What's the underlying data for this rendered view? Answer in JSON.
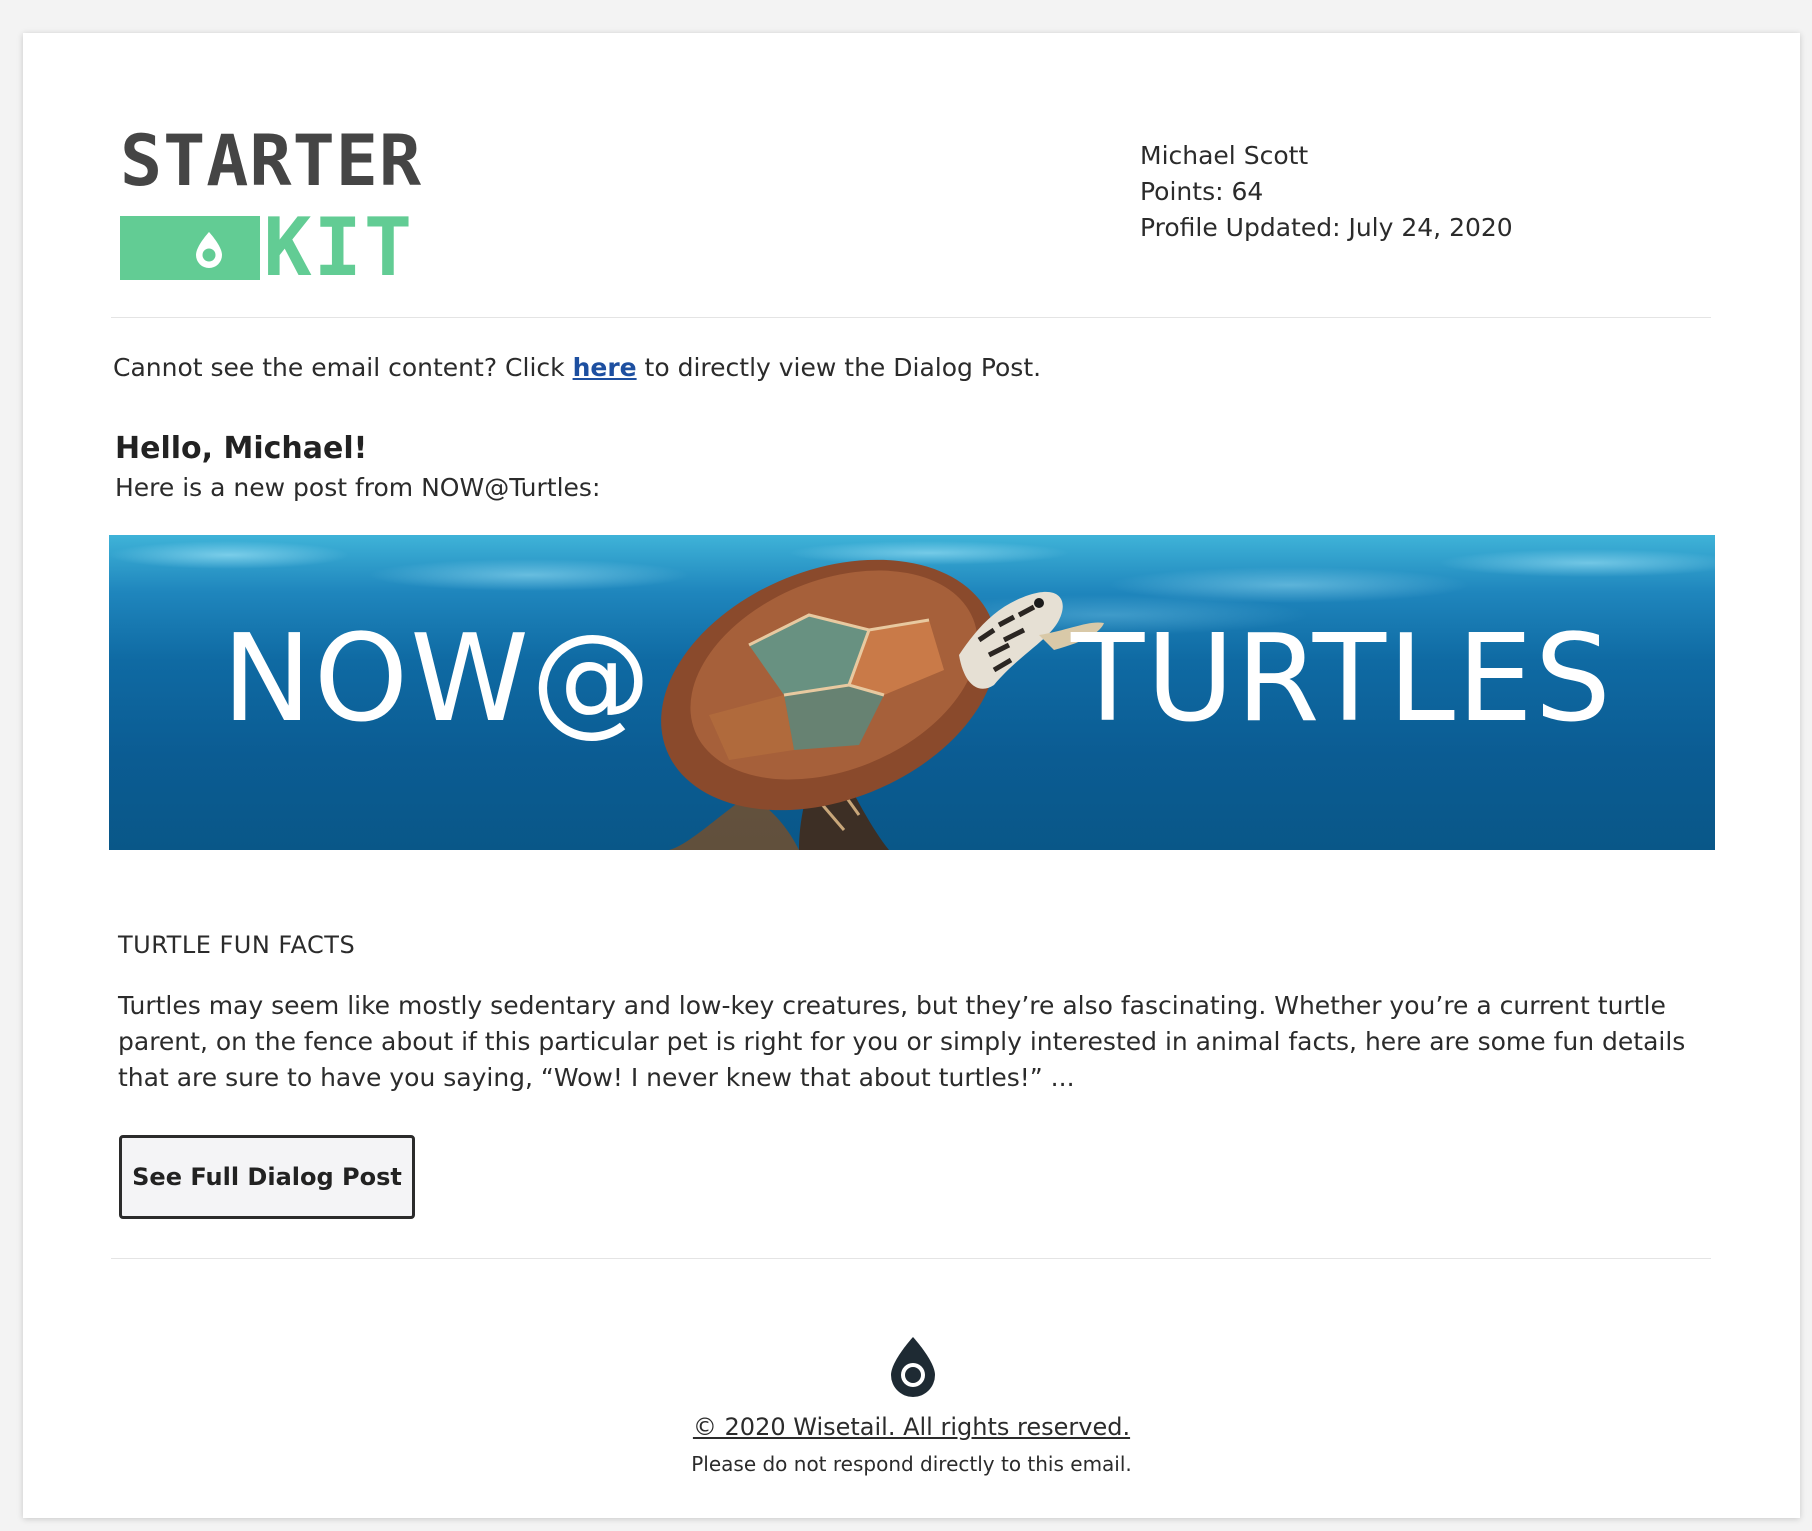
{
  "header": {
    "logo": {
      "line1": "STARTER",
      "line2": "KIT",
      "brand_color": "#62cc94",
      "icon": "drop-icon"
    },
    "profile": {
      "name": "Michael Scott",
      "points": "Points: 64",
      "updated": "Profile Updated: July 24, 2020"
    }
  },
  "notice": {
    "before": "Cannot see the email content? Click ",
    "link": "here",
    "after": " to directly view the Dialog Post.",
    "link_color": "#1d4fa0"
  },
  "greeting": "Hello, Michael!",
  "intro": "Here is a new post from NOW@Turtles:",
  "banner": {
    "left_text": "NOW@",
    "right_text": "TURTLES",
    "background": "#0b5c93"
  },
  "post": {
    "title": "TURTLE FUN FACTS",
    "body": "Turtles may seem like mostly sedentary and low-key creatures, but they’re also fascinating. Whether you’re a current turtle parent, on the fence about if this particular pet is right for you or simply interested in animal facts, here are some fun details that are sure to have you saying, “Wow! I never knew that about turtles!” ..."
  },
  "cta": {
    "label": "See Full Dialog Post"
  },
  "footer": {
    "icon": "drop-icon",
    "copyright": "© 2020 Wisetail. All rights reserved.",
    "disclaimer": "Please do not respond directly to this email."
  }
}
